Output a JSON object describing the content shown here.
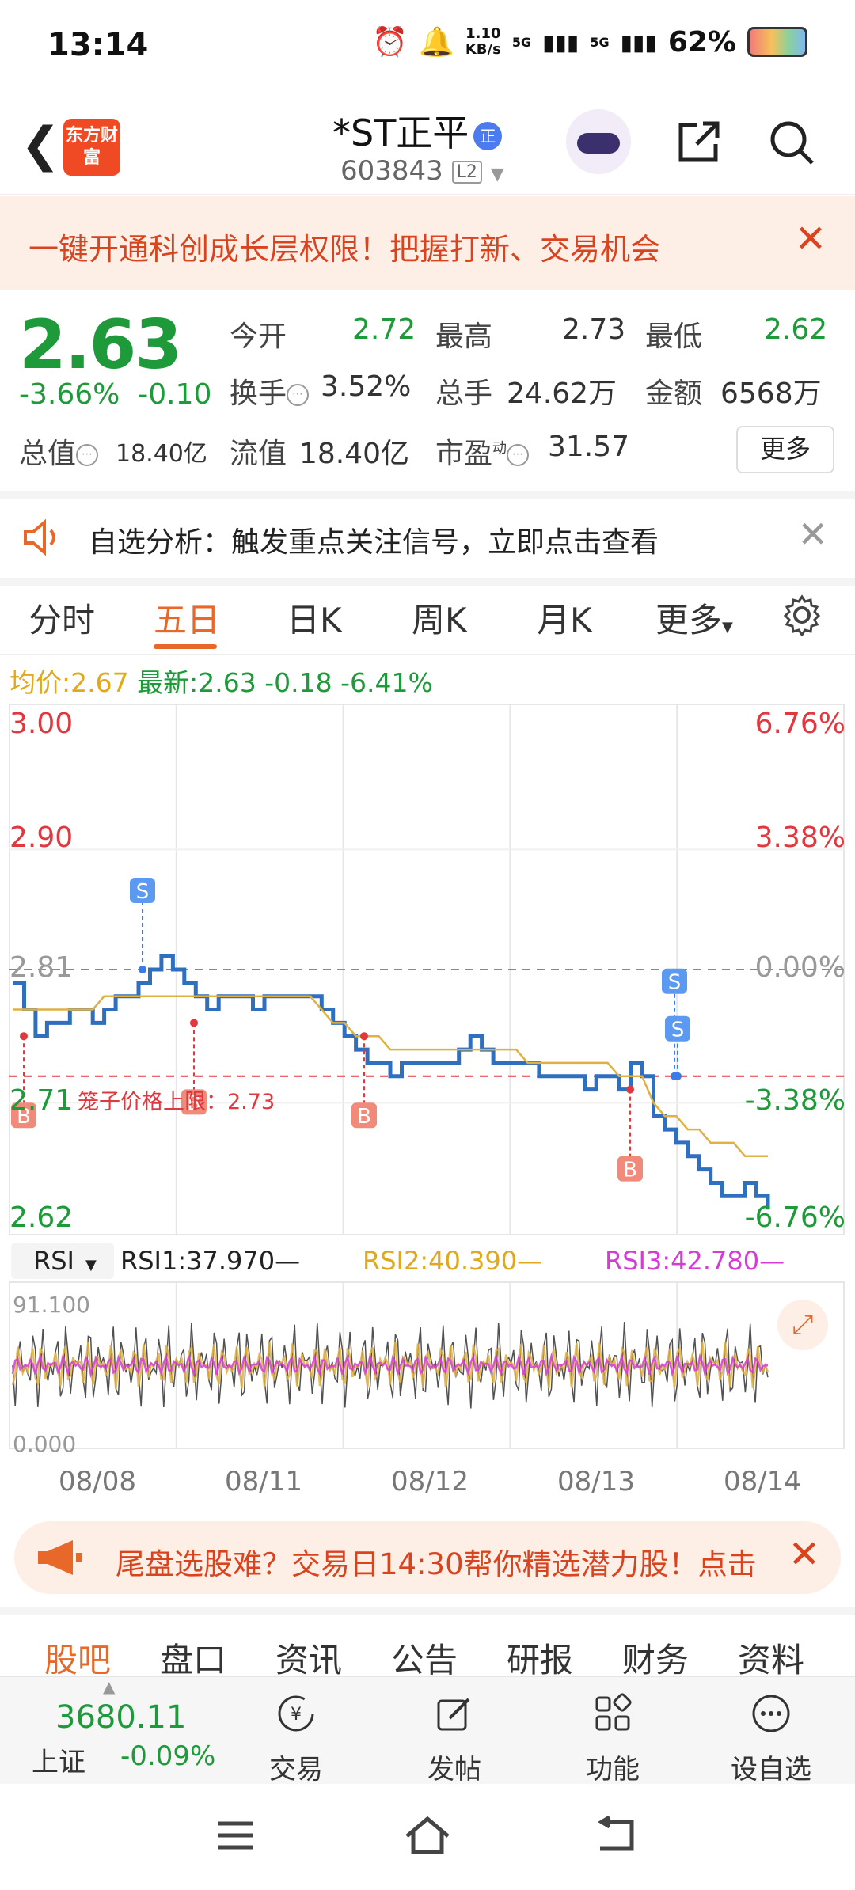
{
  "status": {
    "time": "13:14",
    "net_speed": "1.10",
    "net_unit": "KB/s",
    "sig1": "5G",
    "sig2": "5G",
    "battery": "62%"
  },
  "header": {
    "logo_text": "东方财富",
    "name": "*ST正平",
    "badge": "正",
    "code": "603843",
    "level": "L2"
  },
  "promo": {
    "text": "一键开通科创成长层权限！把握打新、交易机会"
  },
  "quote": {
    "price": "2.63",
    "change_pct": "-3.66%",
    "change": "-0.10",
    "open_label": "今开",
    "open": "2.72",
    "high_label": "最高",
    "high": "2.73",
    "low_label": "最低",
    "low": "2.62",
    "turnover_label": "换手",
    "turnover": "3.52%",
    "volume_label": "总手",
    "volume": "24.62万",
    "amount_label": "金额",
    "amount": "6568万",
    "mcap_label": "总值",
    "mcap": "18.40亿",
    "float_label": "流值",
    "float": "18.40亿",
    "pe_label": "市盈",
    "pe_sup": "动",
    "pe": "31.57",
    "more": "更多"
  },
  "notice": {
    "text": "自选分析：触发重点关注信号，立即点击查看"
  },
  "tabs": [
    "分时",
    "五日",
    "日K",
    "周K",
    "月K",
    "更多"
  ],
  "info": {
    "avg_label": "均价:",
    "avg": "2.67",
    "last_label": "最新:",
    "last": "2.63",
    "chg": "-0.18",
    "pct": "-6.41%"
  },
  "chart_data": {
    "type": "line",
    "y_left_ticks": [
      "3.00",
      "2.90",
      "2.81",
      "2.71",
      "2.62"
    ],
    "y_right_ticks": [
      "6.76%",
      "3.38%",
      "0.00%",
      "-3.38%",
      "-6.76%"
    ],
    "x_labels": [
      "08/08",
      "08/11",
      "08/12",
      "08/13",
      "08/14"
    ],
    "ylim": [
      2.62,
      3.0
    ],
    "limit_label": "笼子价格上限：2.73",
    "markers": [
      "B",
      "S",
      "B",
      "B",
      "B",
      "S",
      "S"
    ],
    "series": [
      {
        "name": "price",
        "color": "#2f6fbf",
        "values": [
          2.8,
          2.78,
          2.76,
          2.77,
          2.77,
          2.78,
          2.78,
          2.77,
          2.78,
          2.79,
          2.79,
          2.8,
          2.81,
          2.82,
          2.81,
          2.8,
          2.79,
          2.78,
          2.79,
          2.79,
          2.79,
          2.78,
          2.79,
          2.79,
          2.79,
          2.79,
          2.79,
          2.78,
          2.77,
          2.76,
          2.75,
          2.74,
          2.74,
          2.73,
          2.74,
          2.74,
          2.74,
          2.74,
          2.74,
          2.75,
          2.76,
          2.75,
          2.74,
          2.74,
          2.74,
          2.74,
          2.73,
          2.73,
          2.73,
          2.73,
          2.72,
          2.73,
          2.73,
          2.72,
          2.74,
          2.73,
          2.7,
          2.69,
          2.68,
          2.67,
          2.66,
          2.65,
          2.64,
          2.64,
          2.65,
          2.64,
          2.63
        ]
      },
      {
        "name": "avg",
        "color": "#e0b040",
        "values": [
          2.78,
          2.78,
          2.78,
          2.78,
          2.78,
          2.78,
          2.78,
          2.78,
          2.79,
          2.79,
          2.79,
          2.79,
          2.79,
          2.79,
          2.79,
          2.79,
          2.79,
          2.79,
          2.79,
          2.79,
          2.79,
          2.79,
          2.79,
          2.79,
          2.79,
          2.79,
          2.79,
          2.78,
          2.77,
          2.77,
          2.76,
          2.76,
          2.76,
          2.75,
          2.75,
          2.75,
          2.75,
          2.75,
          2.75,
          2.75,
          2.75,
          2.75,
          2.75,
          2.75,
          2.75,
          2.74,
          2.74,
          2.74,
          2.74,
          2.74,
          2.74,
          2.74,
          2.74,
          2.73,
          2.73,
          2.73,
          2.71,
          2.7,
          2.7,
          2.69,
          2.69,
          2.68,
          2.68,
          2.68,
          2.67,
          2.67,
          2.67
        ]
      }
    ],
    "rsi": {
      "label": "RSI",
      "rsi1": "RSI1:37.970—",
      "rsi2": "RSI2:40.390—",
      "rsi3": "RSI3:42.780—",
      "top": "91.100",
      "bottom": "0.000"
    }
  },
  "bottom_promo": {
    "text": "尾盘选股难？交易日14:30帮你精选潜力股！点击"
  },
  "subtabs": [
    "股吧",
    "盘口",
    "资讯",
    "公告",
    "研报",
    "财务",
    "资料"
  ],
  "bottom_nav": {
    "index_value": "3680.11",
    "index_name": "上证",
    "index_chg": "-0.09%",
    "items": [
      "交易",
      "发帖",
      "功能",
      "设自选"
    ]
  },
  "colors": {
    "up": "#e0383e",
    "down": "#1e9a3a",
    "accent": "#e8682a"
  }
}
